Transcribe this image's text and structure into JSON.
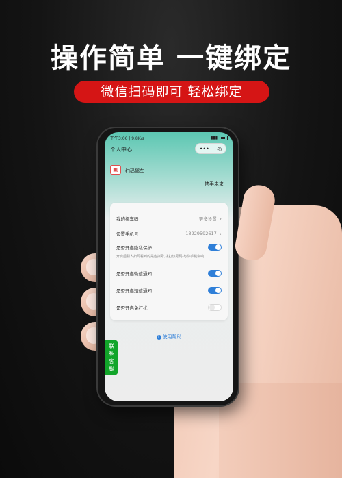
{
  "promo": {
    "headline": "操作简单 一键绑定",
    "subheadline": "微信扫码即可 轻松绑定"
  },
  "status_bar": {
    "time_speed": "下午3:06 | 9.8K/s",
    "signal": "▮▮▮"
  },
  "nav": {
    "title": "个人中心",
    "capsule_more": "•••",
    "capsule_close": "◎"
  },
  "scan": {
    "icon_glyph": "▣",
    "label": "扫码挪车"
  },
  "brand": "携手未来",
  "settings": {
    "my_plate_label": "我的挪车码",
    "my_plate_value": "更多设置",
    "phone_label": "设置手机号",
    "phone_value": "18229592617",
    "privacy_label": "是否开启隐私保护",
    "privacy_desc": "开启后别人扫码看到的是虚拟号,拨打该号码,与你手机会响",
    "wechat_notify_label": "是否开启微信通知",
    "sms_notify_label": "是否开启短信通知",
    "dnd_label": "是否开启免打扰",
    "toggles": {
      "privacy": true,
      "wechat": true,
      "sms": true,
      "dnd": false
    }
  },
  "help_link": "使用帮助",
  "service_button": "联系客服",
  "colors": {
    "accent_blue": "#2f7fd8",
    "service_green": "#12a52a",
    "pill_red": "#d51515",
    "teal": "#5cc7b2"
  }
}
